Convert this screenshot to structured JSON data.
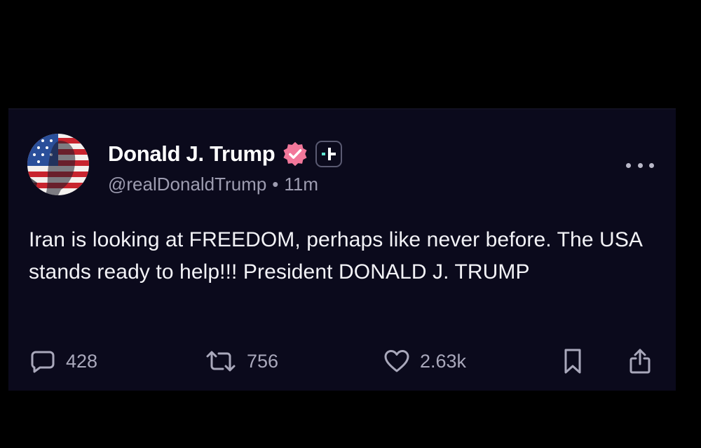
{
  "author": {
    "display_name": "Donald J. Trump",
    "handle": "@realDonaldTrump",
    "separator": "•",
    "timestamp": "11m",
    "verified_icon": "verified-badge-icon",
    "plus_icon": "truth-plus-icon"
  },
  "post": {
    "text": "Iran is looking at FREEDOM, perhaps like never before. The USA stands ready to help!!! President DONALD J. TRUMP"
  },
  "actions": {
    "replies": "428",
    "retruths": "756",
    "likes": "2.63k"
  },
  "colors": {
    "background": "#000000",
    "card": "#0b0a1c",
    "verified": "#f2779a",
    "accent_teal": "#5fe3cf",
    "muted_text": "#9d9cb0"
  }
}
